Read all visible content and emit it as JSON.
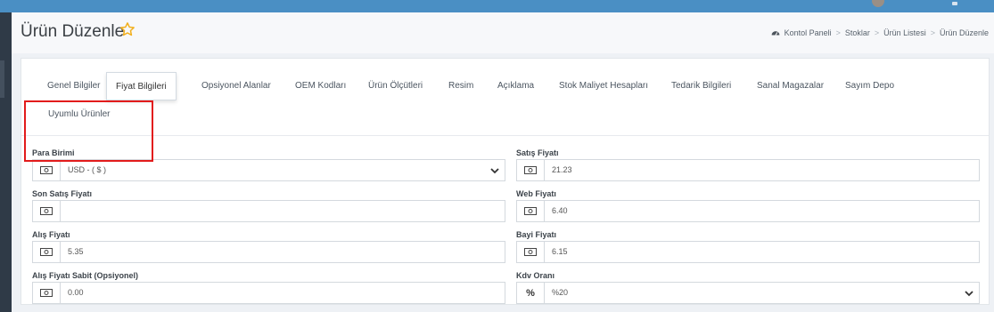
{
  "page": {
    "title": "Ürün Düzenle",
    "breadcrumb": [
      "Kontol Paneli",
      "Stoklar",
      "Ürün Listesi",
      "Ürün Düzenle"
    ]
  },
  "tabs": [
    {
      "label": "Genel Bilgiler",
      "active": false
    },
    {
      "label": "Fiyat Bilgileri",
      "active": true
    },
    {
      "label": "Opsiyonel Alanlar",
      "active": false
    },
    {
      "label": "OEM Kodları",
      "active": false
    },
    {
      "label": "Ürün Ölçütleri",
      "active": false
    },
    {
      "label": "Resim",
      "active": false
    },
    {
      "label": "Açıklama",
      "active": false
    },
    {
      "label": "Stok Maliyet Hesapları",
      "active": false
    },
    {
      "label": "Tedarik Bilgileri",
      "active": false
    },
    {
      "label": "Sanal Magazalar",
      "active": false
    },
    {
      "label": "Sayım Depo",
      "active": false
    },
    {
      "label": "Uyumlu Ürünler",
      "active": false
    }
  ],
  "form": {
    "para_birimi": {
      "label": "Para Birimi",
      "value": "USD - ( $ )"
    },
    "son_satis_fiyati": {
      "label": "Son Satış Fiyatı",
      "value": ""
    },
    "alis_fiyati": {
      "label": "Alış Fiyatı",
      "value": "5.35"
    },
    "alis_fiyati_sabit": {
      "label": "Alış Fiyatı Sabit (Opsiyonel)",
      "value": "0.00"
    },
    "satis_fiyati": {
      "label": "Satış Fiyatı",
      "value": "21.23"
    },
    "web_fiyati": {
      "label": "Web Fiyatı",
      "value": "6.40"
    },
    "bayi_fiyati": {
      "label": "Bayi Fiyatı",
      "value": "6.15"
    },
    "kdv_orani": {
      "label": "Kdv Oranı",
      "value": "%20",
      "addon": "%"
    }
  },
  "icons": {
    "money": "money-icon",
    "percent": "percent-icon",
    "star": "star-icon",
    "home": "dashboard-icon",
    "chevron": "chevron-down-icon"
  },
  "colors": {
    "topbar": "#4a8fc4",
    "sidebar": "#2f3a47",
    "highlight": "#e21b1b",
    "star": "#f2b01e"
  }
}
